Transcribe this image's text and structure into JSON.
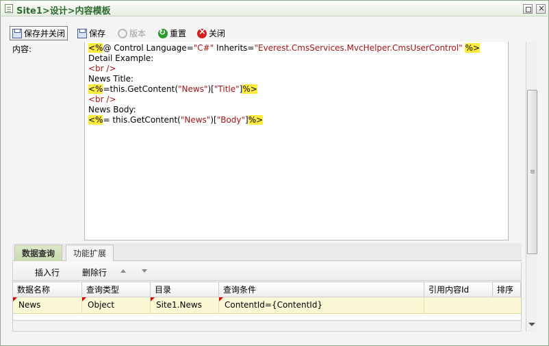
{
  "window": {
    "title": "Site1>设计>内容模板"
  },
  "toolbar": {
    "save_close": "保存并关闭",
    "save": "保存",
    "version": "版本",
    "reset": "重置",
    "close": "关闭"
  },
  "form": {
    "content_label": "内容:"
  },
  "editor": {
    "line1": {
      "open": "<%",
      "mid1": "@ Control Language=",
      "lang": "\"C#\"",
      "mid2": " Inherits=",
      "inherits": "\"Everest.CmsServices.MvcHelper.CmsUserControl\"",
      "space": " ",
      "close": "%>"
    },
    "line2": "Detail Example:",
    "line3": "<br />",
    "line4": "News Title:",
    "line5": {
      "open": "<%",
      "a": "=this.GetContent(",
      "s1": "\"News\"",
      "b": ")[",
      "s2": "\"Title\"",
      "c": "]",
      "close": "%>"
    },
    "line6": "<br />",
    "line7": "News Body:",
    "line8": {
      "open": "<%",
      "a": "= this.GetContent(",
      "s1": "\"News\"",
      "b": ")[",
      "s2": "\"Body\"",
      "c": "]",
      "close": "%>"
    }
  },
  "tabs": {
    "data_query": "数据查询",
    "extension": "功能扩展"
  },
  "grid_toolbar": {
    "insert_row": "插入行",
    "delete_row": "删除行"
  },
  "grid": {
    "headers": [
      "数据名称",
      "查询类型",
      "目录",
      "查询条件",
      "引用内容Id",
      "排序"
    ],
    "rows": [
      [
        "News",
        "Object",
        "Site1.News",
        "ContentId={ContentId}",
        "",
        ""
      ]
    ]
  },
  "colors": {
    "highlight": "#ffeb3b",
    "row_bg": "#fbf8d6",
    "title": "#2e6b2e"
  }
}
